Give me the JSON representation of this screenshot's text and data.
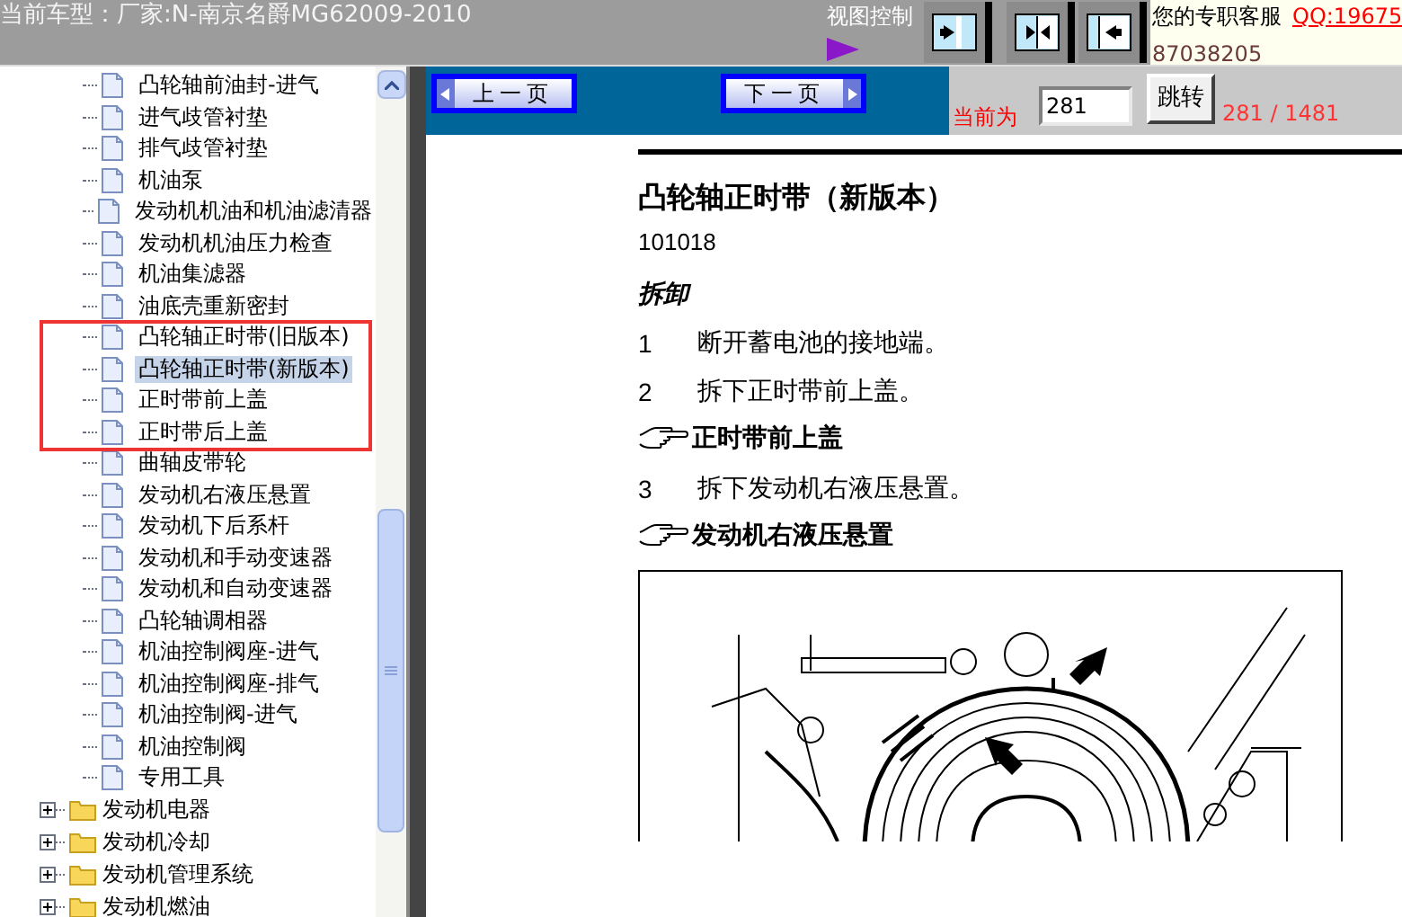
{
  "header": {
    "title": "当前车型：厂家:N-南京名爵MG62009-2010",
    "view_control_label": "视图控制",
    "service_label": "您的专职客服",
    "qq_link": "QQ:19675",
    "phone": "87038205"
  },
  "tree": {
    "leaves": [
      {
        "label": "凸轮轴前油封-进气",
        "selected": false,
        "outlined": false
      },
      {
        "label": "进气歧管衬垫",
        "selected": false,
        "outlined": false
      },
      {
        "label": "排气歧管衬垫",
        "selected": false,
        "outlined": false
      },
      {
        "label": "机油泵",
        "selected": false,
        "outlined": false
      },
      {
        "label": "发动机机油和机油滤清器",
        "selected": false,
        "outlined": false
      },
      {
        "label": "发动机机油压力检查",
        "selected": false,
        "outlined": false
      },
      {
        "label": "机油集滤器",
        "selected": false,
        "outlined": false
      },
      {
        "label": "油底壳重新密封",
        "selected": false,
        "outlined": false
      },
      {
        "label": "凸轮轴正时带(旧版本)",
        "selected": false,
        "outlined": true
      },
      {
        "label": "凸轮轴正时带(新版本)",
        "selected": true,
        "outlined": true
      },
      {
        "label": "正时带前上盖",
        "selected": false,
        "outlined": true
      },
      {
        "label": "正时带后上盖",
        "selected": false,
        "outlined": true
      },
      {
        "label": "曲轴皮带轮",
        "selected": false,
        "outlined": false
      },
      {
        "label": "发动机右液压悬置",
        "selected": false,
        "outlined": false
      },
      {
        "label": "发动机下后系杆",
        "selected": false,
        "outlined": false
      },
      {
        "label": "发动机和手动变速器",
        "selected": false,
        "outlined": false
      },
      {
        "label": "发动机和自动变速器",
        "selected": false,
        "outlined": false
      },
      {
        "label": "凸轮轴调相器",
        "selected": false,
        "outlined": false
      },
      {
        "label": "机油控制阀座-进气",
        "selected": false,
        "outlined": false
      },
      {
        "label": "机油控制阀座-排气",
        "selected": false,
        "outlined": false
      },
      {
        "label": "机油控制阀-进气",
        "selected": false,
        "outlined": false
      },
      {
        "label": "机油控制阀",
        "selected": false,
        "outlined": false
      },
      {
        "label": "专用工具",
        "selected": false,
        "outlined": false
      }
    ],
    "folders": [
      {
        "label": "发动机电器",
        "expanded": false
      },
      {
        "label": "发动机冷却",
        "expanded": false
      },
      {
        "label": "发动机管理系统",
        "expanded": false
      },
      {
        "label": "发动机燃油",
        "expanded": false
      }
    ]
  },
  "pager": {
    "prev": "上一页",
    "next": "下一页",
    "current_label": "当前为",
    "page_value": "281",
    "go_button": "跳转",
    "page_count": "281 / 1481"
  },
  "document": {
    "title": "凸轮轴正时带（新版本）",
    "code": "101018",
    "section": "拆卸",
    "blocks": [
      {
        "kind": "step",
        "number": "1",
        "text": "断开蓄电池的接地端。"
      },
      {
        "kind": "step",
        "number": "2",
        "text": "拆下正时带前上盖。"
      },
      {
        "kind": "reference",
        "text": "正时带前上盖"
      },
      {
        "kind": "step",
        "number": "3",
        "text": "拆下发动机右液压悬置。"
      },
      {
        "kind": "reference",
        "text": "发动机右液压悬置"
      }
    ]
  }
}
